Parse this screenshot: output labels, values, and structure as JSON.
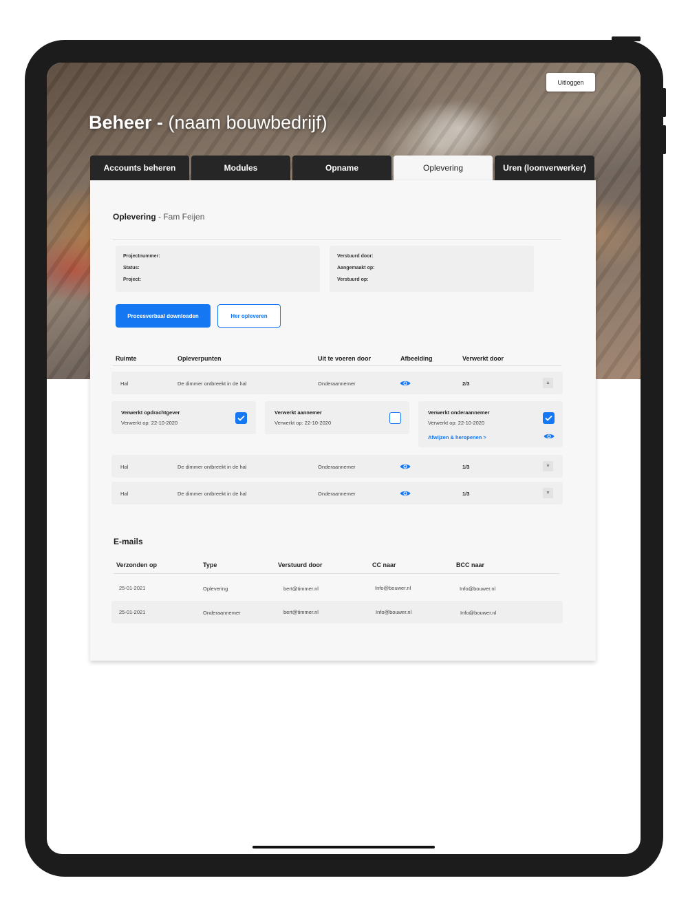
{
  "header": {
    "logout_label": "Uitloggen",
    "title_bold": "Beheer -",
    "title_rest": " (naam bouwbedrijf)"
  },
  "tabs": [
    {
      "label": "Accounts beheren",
      "active": false
    },
    {
      "label": "Modules",
      "active": false
    },
    {
      "label": "Opname",
      "active": false
    },
    {
      "label": "Oplevering",
      "active": true
    },
    {
      "label": "Uren (loonverwerker)",
      "active": false
    }
  ],
  "section": {
    "title": "Oplevering",
    "subtitle": " - Fam Feijen"
  },
  "info_left": [
    "Projectnummer:",
    "Status:",
    "Project:"
  ],
  "info_right": [
    "Verstuurd door:",
    "Aangemaakt op:",
    "Verstuurd op:"
  ],
  "actions": {
    "download_label": "Procesverbaal downloaden",
    "redo_label": "Her opleveren"
  },
  "points_table": {
    "headers": [
      "Ruimte",
      "Opleverpunten",
      "Uit te voeren door",
      "Afbeelding",
      "Verwerkt door"
    ],
    "rows": [
      {
        "ruimte": "Hal",
        "punt": "De dimmer ontbreekt in de hal",
        "door": "Onderaannemer",
        "verwerkt": "2/3",
        "expanded": true
      },
      {
        "ruimte": "Hal",
        "punt": "De dimmer ontbreekt in de hal",
        "door": "Onderaannemer",
        "verwerkt": "1/3",
        "expanded": false
      },
      {
        "ruimte": "Hal",
        "punt": "De dimmer ontbreekt in de hal",
        "door": "Onderaannemer",
        "verwerkt": "1/3",
        "expanded": false
      }
    ],
    "detail": [
      {
        "title": "Verwerkt opdrachtgever",
        "date": "Verwerkt op: 22-10-2020",
        "checked": true
      },
      {
        "title": "Verwerkt aannemer",
        "date": "Verwerkt op: 22-10-2020",
        "checked": false
      },
      {
        "title": "Verwerkt onderaannemer",
        "date": "Verwerkt op: 22-10-2020",
        "checked": true,
        "link": "Afwijzen & heropenen >"
      }
    ]
  },
  "emails": {
    "title": "E-mails",
    "headers": [
      "Verzonden op",
      "Type",
      "Verstuurd door",
      "CC naar",
      "BCC naar"
    ],
    "rows": [
      [
        "25-01-2021",
        "Oplevering",
        "bert@timmer.nl",
        "Info@bouwer.nl",
        "Info@bouwer.nl"
      ],
      [
        "25-01-2021",
        "Onderaannemer",
        "bert@timmer.nl",
        "Info@bouwer.nl",
        "Info@bouwer.nl"
      ]
    ]
  },
  "colors": {
    "accent": "#1677f2",
    "tab_dark": "#262626",
    "card_bg": "#f7f7f7",
    "row_bg": "#efefef"
  }
}
